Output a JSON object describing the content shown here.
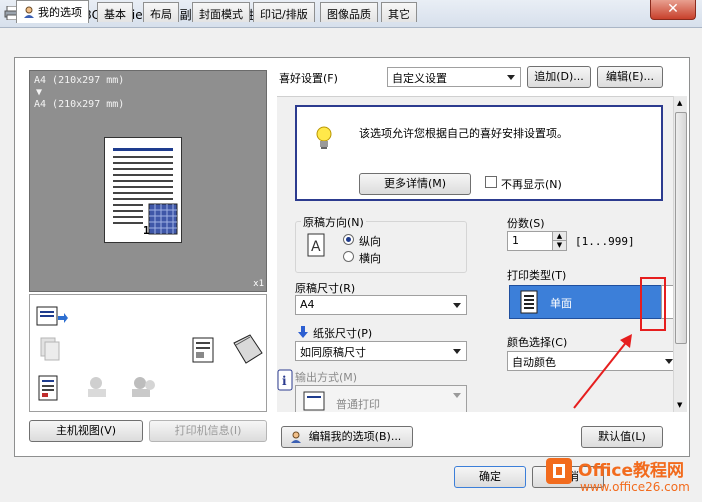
{
  "window": {
    "title": "Generic 28C-2SeriesPCL (副本 10) 属性",
    "close_label": "✕"
  },
  "tabs": [
    {
      "label": "我的选项"
    },
    {
      "label": "基本"
    },
    {
      "label": "布局"
    },
    {
      "label": "封面模式"
    },
    {
      "label": "印记/排版"
    },
    {
      "label": "图像品质"
    },
    {
      "label": "其它"
    }
  ],
  "preview": {
    "line1": "A4  (210x297  mm)",
    "arrow": "▼",
    "line2": "A4  (210x297  mm)",
    "page_number": "1",
    "copies_mark": "x1"
  },
  "left_buttons": {
    "main_view": "主机视图(V)",
    "printer_info": "打印机信息(I)"
  },
  "favorites": {
    "label": "喜好设置(F)",
    "value": "自定义设置",
    "add_label": "追加(D)...",
    "edit_label": "编辑(E)..."
  },
  "info": {
    "message": "该选项允许您根据自己的喜好安排设置项。",
    "more_details": "更多详情(M)",
    "dont_show": "不再显示(N)"
  },
  "orientation": {
    "label": "原稿方向(N)",
    "portrait": "纵向",
    "landscape": "横向"
  },
  "original_size": {
    "label": "原稿尺寸(R)",
    "value": "A4"
  },
  "paper_size": {
    "label": "纸张尺寸(P)",
    "value": "如同原稿尺寸"
  },
  "output": {
    "label": "输出方式(M)",
    "value": "普通打印"
  },
  "copies": {
    "label": "份数(S)",
    "value": "1",
    "range": "[1...999]"
  },
  "print_type": {
    "label": "打印类型(T)",
    "value": "单面"
  },
  "color": {
    "label": "颜色选择(C)",
    "value": "自动颜色"
  },
  "bottom": {
    "edit_my_options": "编辑我的选项(B)...",
    "defaults": "默认值(L)",
    "ok": "确定",
    "cancel": "取消"
  },
  "watermark": {
    "brand": "Office教程网",
    "url": "www.office26.com"
  },
  "colors": {
    "accent_blue": "#3c7fd9",
    "annotation_red": "#e61e1e",
    "brand_orange": "#f26b1d"
  }
}
